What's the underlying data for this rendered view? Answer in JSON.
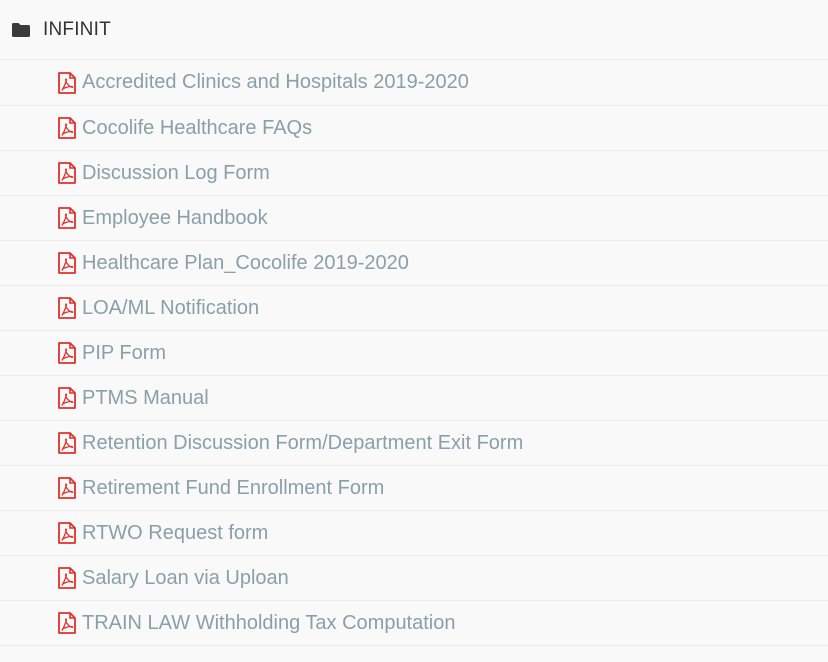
{
  "folder": {
    "name": "INFINIT",
    "icon": "folder-icon"
  },
  "colors": {
    "pdf_icon": "#e0312b",
    "link_text": "#8a9fa8",
    "folder_text": "#333333"
  },
  "files": [
    {
      "label": "Accredited Clinics and Hospitals 2019-2020",
      "icon": "pdf-file-icon"
    },
    {
      "label": "Cocolife Healthcare FAQs",
      "icon": "pdf-file-icon"
    },
    {
      "label": "Discussion Log Form",
      "icon": "pdf-file-icon"
    },
    {
      "label": "Employee Handbook",
      "icon": "pdf-file-icon"
    },
    {
      "label": "Healthcare Plan_Cocolife 2019-2020",
      "icon": "pdf-file-icon"
    },
    {
      "label": "LOA/ML Notification",
      "icon": "pdf-file-icon"
    },
    {
      "label": "PIP Form",
      "icon": "pdf-file-icon"
    },
    {
      "label": "PTMS Manual",
      "icon": "pdf-file-icon"
    },
    {
      "label": "Retention Discussion Form/Department Exit Form",
      "icon": "pdf-file-icon"
    },
    {
      "label": "Retirement Fund Enrollment Form",
      "icon": "pdf-file-icon"
    },
    {
      "label": "RTWO Request form",
      "icon": "pdf-file-icon"
    },
    {
      "label": "Salary Loan via Uploan",
      "icon": "pdf-file-icon"
    },
    {
      "label": "TRAIN LAW Withholding Tax Computation",
      "icon": "pdf-file-icon"
    }
  ]
}
